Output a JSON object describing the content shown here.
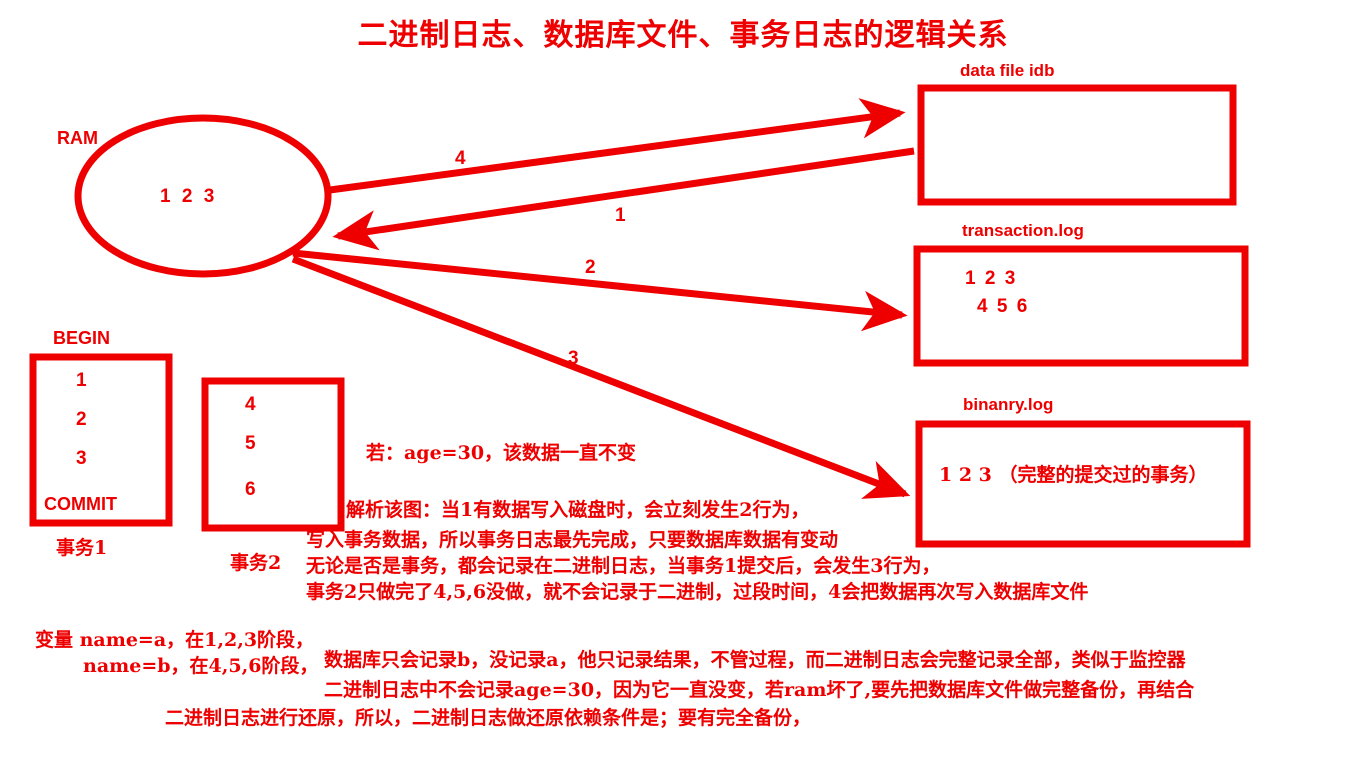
{
  "title": "二进制日志、数据库文件、事务日志的逻辑关系",
  "ram": {
    "label": "RAM",
    "content": "1 2 3"
  },
  "boxes": {
    "data_file": {
      "caption": "data file idb",
      "content": ""
    },
    "transaction_log": {
      "caption": "transaction.log",
      "line1": "1 2 3",
      "line2": "4 5 6"
    },
    "binary_log": {
      "caption": "binanry.log",
      "content": "1 2 3 （完整的提交过的事务）"
    }
  },
  "arrows": {
    "a4": "4",
    "a1": "1",
    "a2": "2",
    "a3": "3"
  },
  "transactions": [
    {
      "begin": "BEGIN",
      "items": [
        "1",
        "2",
        "3"
      ],
      "commit": "COMMIT",
      "caption": "事务1"
    },
    {
      "items": [
        "4",
        "5",
        "6"
      ],
      "caption": "事务2"
    }
  ],
  "notes": {
    "age_note": "若：age=30，该数据一直不变",
    "explain_line1": "解析该图：当1有数据写入磁盘时，会立刻发生2行为，",
    "explain_line2": "写入事务数据，所以事务日志最先完成，只要数据库数据有变动",
    "explain_line3": "无论是否是事务，都会记录在二进制日志，当事务1提交后，会发生3行为，",
    "explain_line4": "事务2只做完了4,5,6没做，就不会记录于二进制，过段时间，4会把数据再次写入数据库文件"
  },
  "bottom": {
    "var_line1": "变量 name=a，在1,2,3阶段，",
    "var_line2": "name=b，在4,5,6阶段，",
    "line1": "数据库只会记录b，没记录a，他只记录结果，不管过程，而二进制日志会完整记录全部，类似于监控器",
    "line2": "二进制日志中不会记录age=30，因为它一直没变，若ram坏了,要先把数据库文件做完整备份，再结合",
    "line3": "二进制日志进行还原，所以，二进制日志做还原依赖条件是；要有完全备份，"
  },
  "colors": {
    "accent": "#ee0000",
    "background": "#ffffff"
  }
}
